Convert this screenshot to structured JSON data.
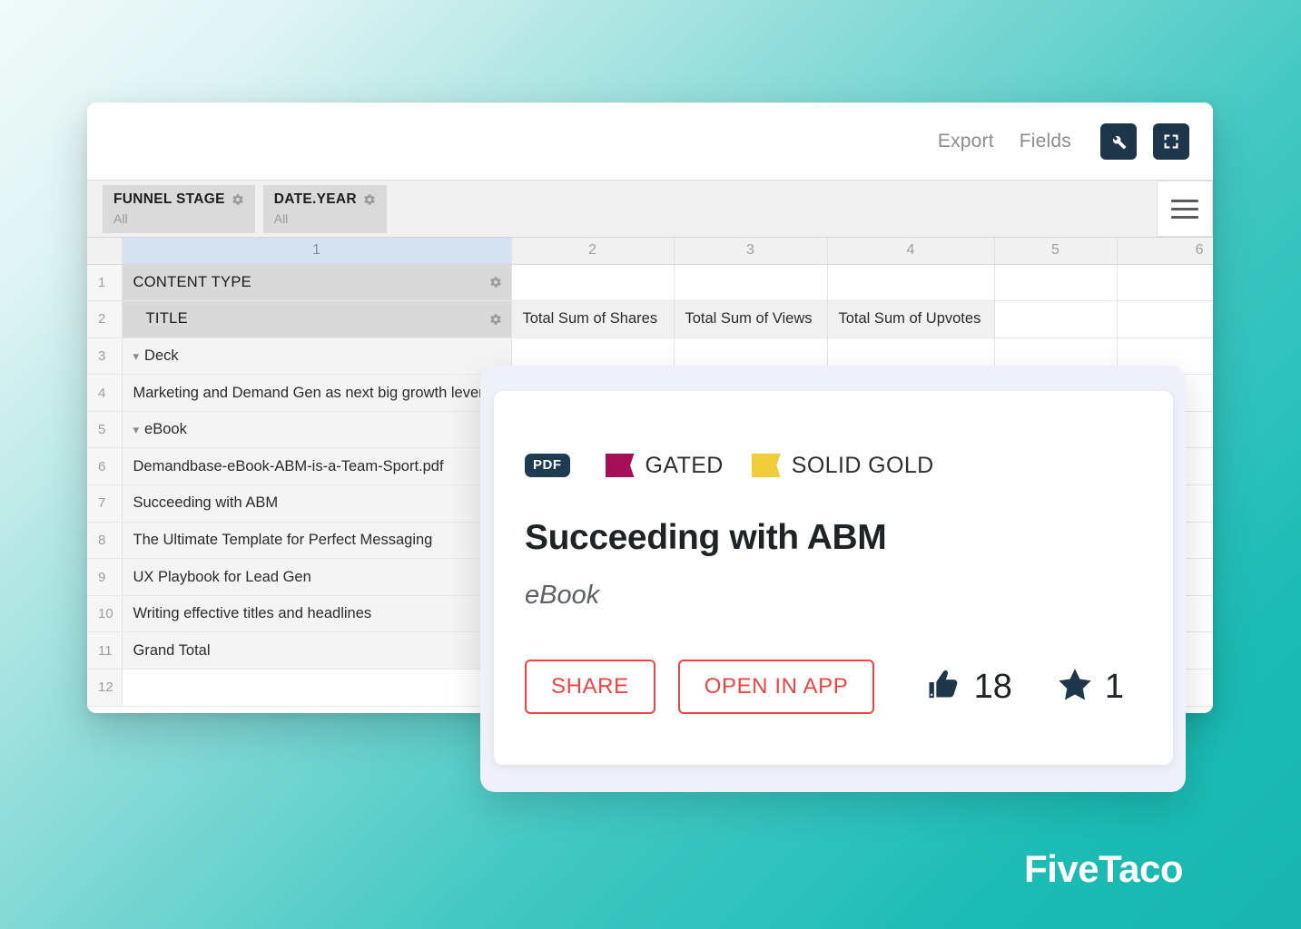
{
  "toolbar": {
    "export_label": "Export",
    "fields_label": "Fields",
    "settings_icon": "wrench-icon",
    "fullscreen_icon": "expand-icon"
  },
  "filters": {
    "menu_icon": "hamburger-menu-icon",
    "chips": [
      {
        "title": "FUNNEL STAGE",
        "value": "All",
        "icon": "gear-icon"
      },
      {
        "title": "DATE.YEAR",
        "value": "All",
        "icon": "gear-icon"
      }
    ]
  },
  "sheet": {
    "column_headers": [
      "1",
      "2",
      "3",
      "4",
      "5",
      "6"
    ],
    "selected_column": "1",
    "rows": [
      {
        "num": "1",
        "kind": "field",
        "label": "CONTENT TYPE",
        "metrics": [
          "",
          "",
          "",
          "",
          ""
        ]
      },
      {
        "num": "2",
        "kind": "field",
        "label": "TITLE",
        "metrics": [
          "Total Sum of Shares",
          "Total Sum of Views",
          "Total Sum of Upvotes",
          "",
          ""
        ]
      },
      {
        "num": "3",
        "kind": "group",
        "label": "Deck",
        "metrics": [
          "",
          "",
          "",
          "",
          ""
        ]
      },
      {
        "num": "4",
        "kind": "data",
        "label": "Marketing and Demand Gen as next big growth lever",
        "metrics": [
          "",
          "",
          "",
          "",
          ""
        ]
      },
      {
        "num": "5",
        "kind": "group",
        "label": "eBook",
        "metrics": [
          "",
          "",
          "",
          "",
          ""
        ]
      },
      {
        "num": "6",
        "kind": "data",
        "label": "Demandbase-eBook-ABM-is-a-Team-Sport.pdf",
        "metrics": [
          "",
          "",
          "",
          "",
          ""
        ]
      },
      {
        "num": "7",
        "kind": "data",
        "label": "Succeeding with ABM",
        "metrics": [
          "",
          "",
          "",
          "",
          ""
        ]
      },
      {
        "num": "8",
        "kind": "data",
        "label": "The Ultimate Template for Perfect Messaging",
        "metrics": [
          "",
          "",
          "",
          "",
          ""
        ]
      },
      {
        "num": "9",
        "kind": "data",
        "label": "UX Playbook for Lead Gen",
        "metrics": [
          "",
          "",
          "",
          "",
          ""
        ]
      },
      {
        "num": "10",
        "kind": "data",
        "label": "Writing effective titles and headlines",
        "metrics": [
          "",
          "",
          "",
          "",
          ""
        ]
      },
      {
        "num": "11",
        "kind": "total",
        "label": "Grand Total",
        "metrics": [
          "",
          "",
          "",
          "",
          ""
        ]
      },
      {
        "num": "12",
        "kind": "empty",
        "label": "",
        "metrics": [
          "",
          "",
          "",
          "",
          ""
        ]
      }
    ]
  },
  "card": {
    "file_type_badge": "PDF",
    "tags": [
      {
        "label": "GATED",
        "color": "#a50f58",
        "icon": "flag-icon"
      },
      {
        "label": "SOLID GOLD",
        "color": "#f0cd39",
        "icon": "flag-icon"
      }
    ],
    "title": "Succeeding with ABM",
    "subtitle": "eBook",
    "share_label": "SHARE",
    "open_label": "OPEN IN APP",
    "stats": [
      {
        "icon": "thumbs-up-icon",
        "value": "18"
      },
      {
        "icon": "star-icon",
        "value": "1"
      }
    ]
  },
  "branding": {
    "logo_text": "FiveTaco"
  },
  "colors": {
    "accent_teal": "#1cbcb4",
    "navy": "#1d3649",
    "red": "#ef4444",
    "gated_magenta": "#a50f58",
    "gold": "#f0cd39"
  }
}
